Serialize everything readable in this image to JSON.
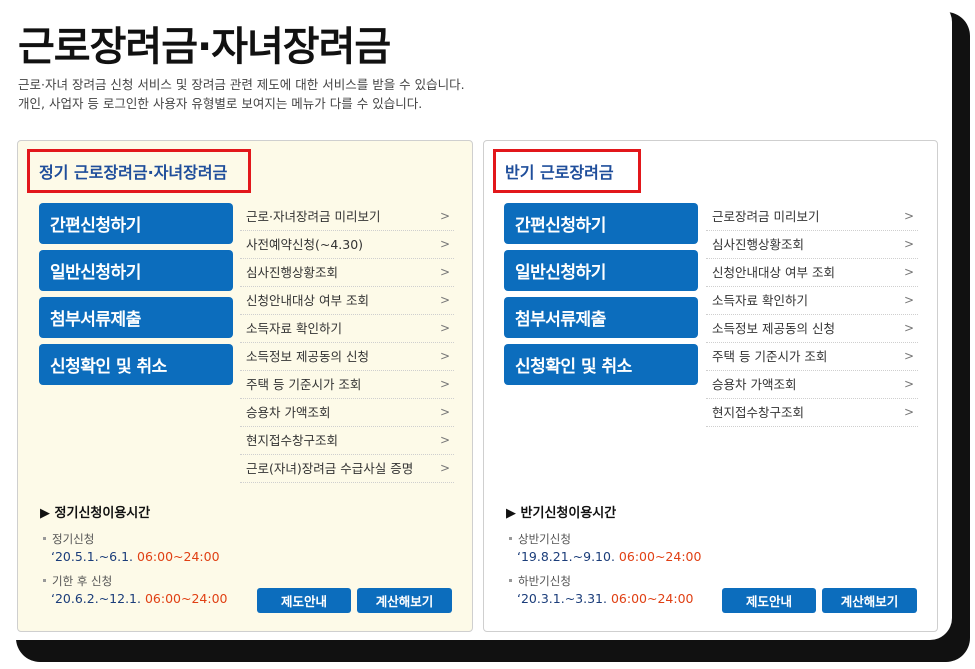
{
  "page": {
    "title": "근로장려금·자녀장려금",
    "desc_line1": "근로·자녀 장려금 신청 서비스 및 장려금 관련 제도에 대한 서비스를 받을 수 있습니다.",
    "desc_line2": "개인, 사업자 등 로그인한 사용자 유형별로 보여지는 메뉴가 다를 수 있습니다."
  },
  "left": {
    "heading": "정기 근로장려금·자녀장려금",
    "buttons": [
      "간편신청하기",
      "일반신청하기",
      "첨부서류제출",
      "신청확인 및 취소"
    ],
    "menu": [
      "근로·자녀장려금 미리보기",
      "사전예약신청(~4.30)",
      "심사진행상황조회",
      "신청안내대상 여부 조회",
      "소득자료 확인하기",
      "소득정보 제공동의 신청",
      "주택 등 기준시가 조회",
      "승용차 가액조회",
      "현지접수창구조회",
      "근로(자녀)장려금 수급사실 증명"
    ],
    "time_title": "정기신청이용시간",
    "times": [
      {
        "label": "정기신청",
        "date": "‘20.5.1.~6.1.",
        "hours": "06:00~24:00"
      },
      {
        "label": "기한 후 신청",
        "date": "‘20.6.2.~12.1.",
        "hours": "06:00~24:00"
      }
    ],
    "btn_info": "제도안내",
    "btn_calc": "계산해보기"
  },
  "right": {
    "heading": "반기 근로장려금",
    "buttons": [
      "간편신청하기",
      "일반신청하기",
      "첨부서류제출",
      "신청확인 및 취소"
    ],
    "menu": [
      "근로장려금 미리보기",
      "심사진행상황조회",
      "신청안내대상 여부 조회",
      "소득자료 확인하기",
      "소득정보 제공동의 신청",
      "주택 등 기준시가 조회",
      "승용차 가액조회",
      "현지접수창구조회"
    ],
    "time_title": "반기신청이용시간",
    "times": [
      {
        "label": "상반기신청",
        "date": "‘19.8.21.~9.10.",
        "hours": "06:00~24:00"
      },
      {
        "label": "하반기신청",
        "date": "‘20.3.1.~3.31.",
        "hours": "06:00~24:00"
      }
    ],
    "btn_info": "제도안내",
    "btn_calc": "계산해보기"
  },
  "icons": {
    "menu_arrow": "chevron-right-icon",
    "section_marker": "triangle-right-icon"
  },
  "colors": {
    "primary_button": "#0c6dbd",
    "highlight_box": "#e2171b",
    "time_highlight": "#e04014",
    "left_panel_bg": "#fdfae8"
  }
}
